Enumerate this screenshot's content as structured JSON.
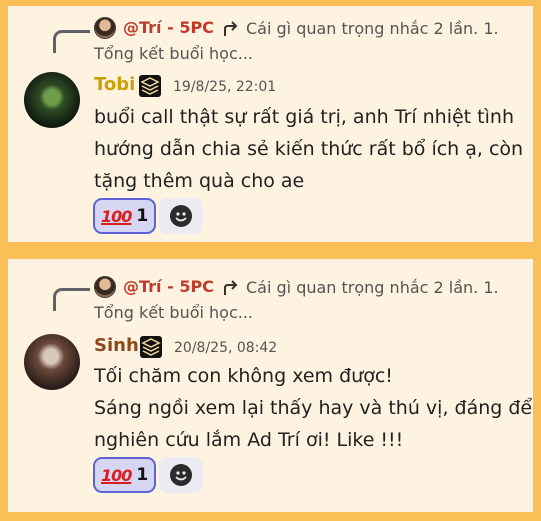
{
  "messages": [
    {
      "reply_name": "@Trí - 5PC",
      "reply_line1": "Cái gì quan trọng nhắc 2 lần.  1.",
      "reply_line2": "Tổng kết buổi học...",
      "author": "Tobi",
      "author_color": "#c9a100",
      "timestamp": "19/8/25, 22:01",
      "lines": [
        "buổi call thật sự rất giá trị, anh Trí nhiệt tình",
        "hướng dẫn chia sẻ kiến thức rất bổ ích ạ, còn",
        "tặng thêm quà cho ae"
      ],
      "reaction_emoji": "100",
      "reaction_count": "1"
    },
    {
      "reply_name": "@Trí - 5PC",
      "reply_line1": "Cái gì quan trọng nhắc 2 lần.  1.",
      "reply_line2": "Tổng kết buổi học...",
      "author": "Sinh",
      "author_color": "#8b4a1c",
      "timestamp": "20/8/25, 08:42",
      "lines": [
        "Tối chăm con không xem được!",
        "Sáng ngồi xem lại thấy hay và thú vị, đáng để",
        "nghiên cứu lắm Ad Trí ơi! Like !!!"
      ],
      "reaction_emoji": "100",
      "reaction_count": "1"
    }
  ]
}
